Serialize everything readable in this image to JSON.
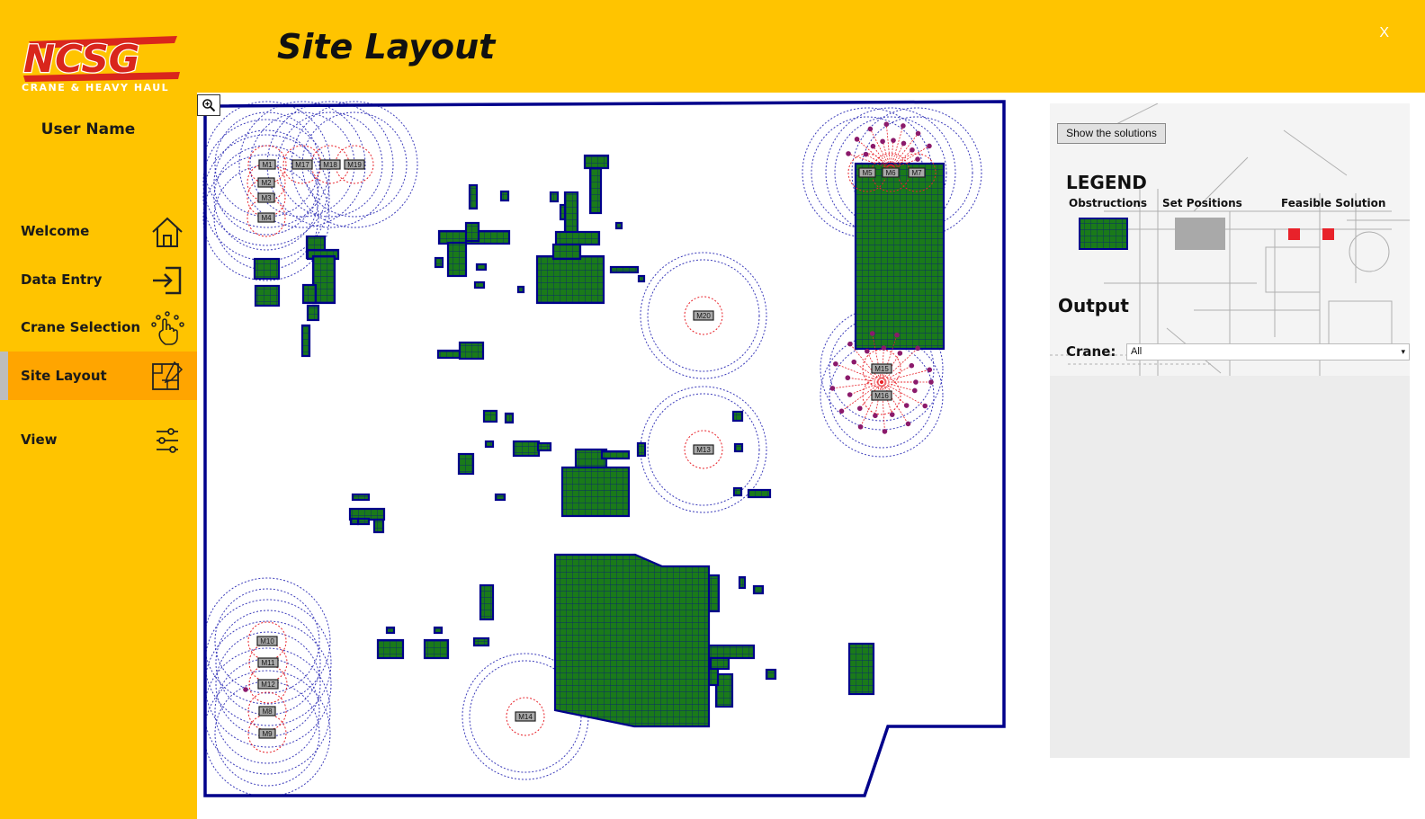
{
  "app": {
    "logo_text": "NCSG",
    "logo_tagline": "CRANE & HEAVY HAUL",
    "user_name": "User Name",
    "close_label": "X"
  },
  "colors": {
    "sidebar": "#ffc400",
    "active_item": "#ffa500",
    "obstruction_fill": "#1a7a1a",
    "obstruction_border": "#00008b",
    "site_border": "#00008b",
    "set_position": "#a9a9a9",
    "feasible_solution": "#e8222a",
    "reach_circle": "#3d3dbb",
    "setup_circle": "#e8222a"
  },
  "nav": [
    {
      "label": "Welcome",
      "icon": "home-icon",
      "active": false
    },
    {
      "label": "Data Entry",
      "icon": "sign-in-icon",
      "active": false
    },
    {
      "label": "Crane Selection",
      "icon": "touch-hand-icon",
      "active": false
    },
    {
      "label": "Site Layout",
      "icon": "blueprint-icon",
      "active": true
    },
    {
      "label": "View",
      "icon": "sliders-icon",
      "active": false
    }
  ],
  "header": {
    "title": "Site Layout"
  },
  "site": {
    "zoom_icon": "zoom-in-icon",
    "markers": [
      "M1",
      "M2",
      "M3",
      "M4",
      "M5",
      "M6",
      "M7",
      "M8",
      "M9",
      "M10",
      "M11",
      "M12",
      "M13",
      "M14",
      "M15",
      "M16",
      "M17",
      "M18",
      "M19",
      "M20"
    ]
  },
  "panel": {
    "show_button": "Show the solutions",
    "legend_title": "LEGEND",
    "legend_items": [
      "Obstructions",
      "Set Positions",
      "Feasible Solution"
    ],
    "output_title": "Output",
    "crane_label": "Crane:",
    "crane_value": "All"
  }
}
